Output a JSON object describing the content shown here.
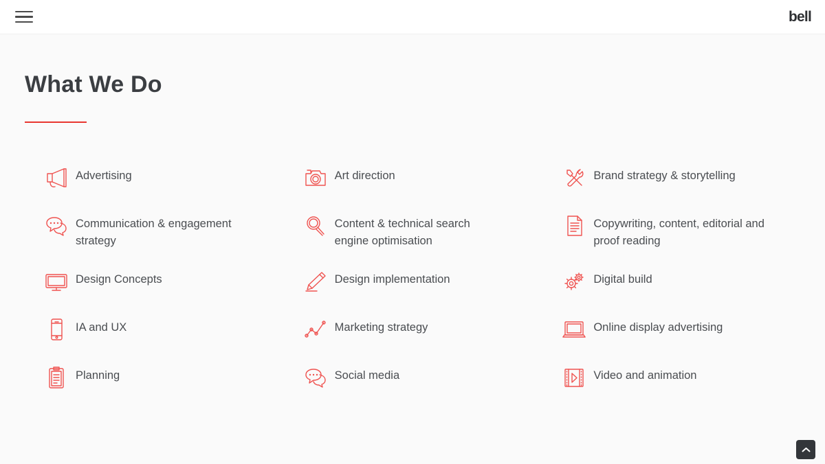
{
  "header": {
    "menu_icon": "hamburger-menu-icon",
    "logo_text": "bell"
  },
  "main": {
    "page_title": "What We Do",
    "accent_color": "#e8352e",
    "icon_color": "#ef5350",
    "text_color": "#4a4d51",
    "background_color": "#fafafa",
    "services": [
      {
        "label": "Advertising",
        "icon": "megaphone-icon"
      },
      {
        "label": "Art direction",
        "icon": "camera-icon"
      },
      {
        "label": "Brand strategy & storytelling",
        "icon": "tools-icon"
      },
      {
        "label": "Communication & engagement strategy",
        "icon": "speech-bubbles-icon"
      },
      {
        "label": "Content & technical search engine optimisation",
        "icon": "magnifier-icon"
      },
      {
        "label": "Copywriting, content, editorial and proof reading",
        "icon": "document-icon"
      },
      {
        "label": "Design Concepts",
        "icon": "monitor-icon"
      },
      {
        "label": "Design implementation",
        "icon": "pencil-icon"
      },
      {
        "label": "Digital build",
        "icon": "gears-icon"
      },
      {
        "label": "IA and UX",
        "icon": "mobile-phone-icon"
      },
      {
        "label": "Marketing strategy",
        "icon": "line-chart-icon"
      },
      {
        "label": "Online display advertising",
        "icon": "laptop-icon"
      },
      {
        "label": "Planning",
        "icon": "clipboard-icon"
      },
      {
        "label": "Social media",
        "icon": "speech-bubbles-icon"
      },
      {
        "label": "Video and animation",
        "icon": "film-play-icon"
      }
    ]
  },
  "footer": {
    "scroll_top_icon": "chevron-up-icon"
  }
}
